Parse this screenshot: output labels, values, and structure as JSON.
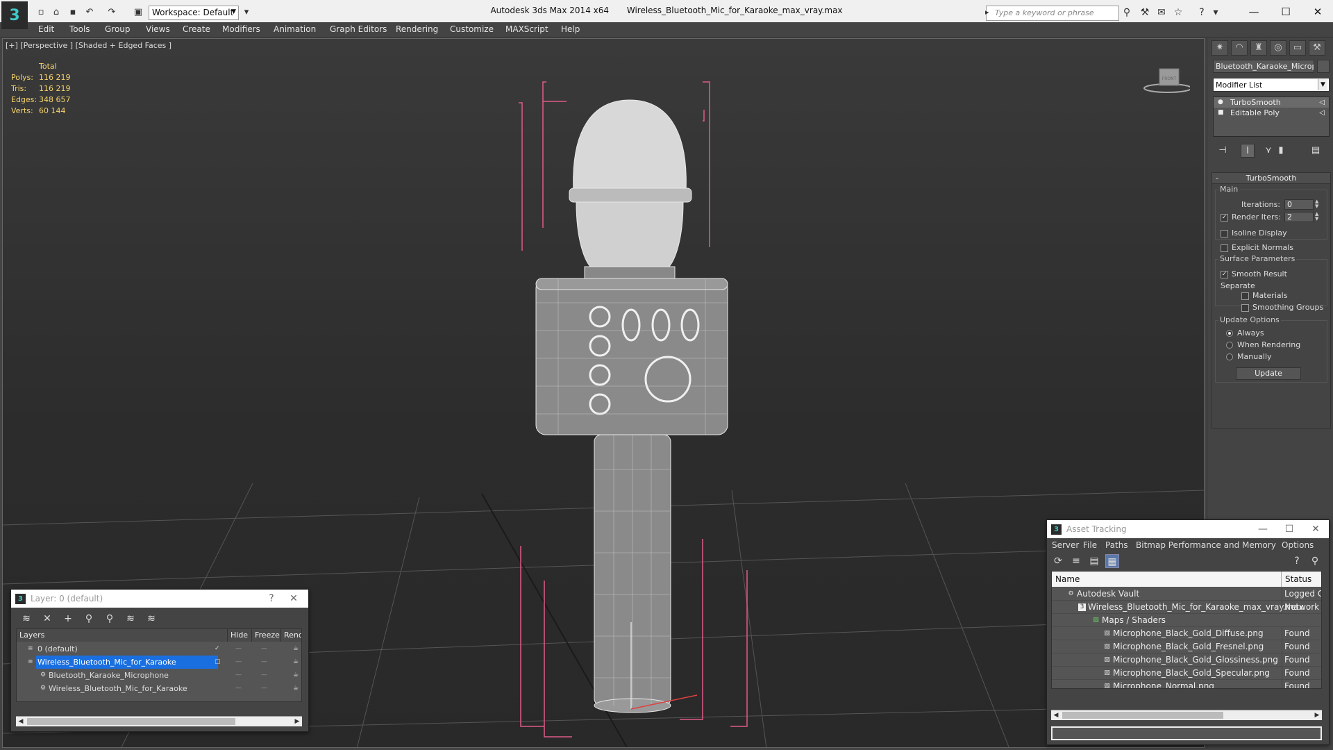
{
  "titlebar": {
    "app_name": "Autodesk 3ds Max  2014 x64",
    "file_name": "Wireless_Bluetooth_Mic_for_Karaoke_max_vray.max",
    "workspace": "Workspace: Default",
    "search_placeholder": "Type a keyword or phrase"
  },
  "menu": [
    "Edit",
    "Tools",
    "Group",
    "Views",
    "Create",
    "Modifiers",
    "Animation",
    "Graph Editors",
    "Rendering",
    "Customize",
    "MAXScript",
    "Help"
  ],
  "viewport": {
    "label": "[+] [Perspective ] [Shaded + Edged Faces ]",
    "stats": {
      "header": "Total",
      "polys_label": "Polys:",
      "polys": "116 219",
      "tris_label": "Tris:",
      "tris": "116 219",
      "edges_label": "Edges:",
      "edges": "348 657",
      "verts_label": "Verts:",
      "verts": "60 144"
    },
    "viewcube_label": "FRONT"
  },
  "command_panel": {
    "object_name": "Bluetooth_Karaoke_Micropho",
    "modifier_list": "Modifier List",
    "stack": [
      "TurboSmooth",
      "Editable Poly"
    ],
    "rollout_title": "TurboSmooth",
    "main_group": "Main",
    "iterations_label": "Iterations:",
    "iterations": "0",
    "render_iters_label": "Render Iters:",
    "render_iters": "2",
    "isoline_display": "Isoline Display",
    "explicit_normals": "Explicit Normals",
    "surface_group": "Surface Parameters",
    "smooth_result": "Smooth Result",
    "separate_label": "Separate",
    "materials": "Materials",
    "smoothing_groups": "Smoothing Groups",
    "update_group": "Update Options",
    "always": "Always",
    "when_rendering": "When Rendering",
    "manually": "Manually",
    "update_button": "Update"
  },
  "layer_window": {
    "title": "Layer: 0 (default)",
    "help": "?",
    "columns": {
      "layers": "Layers",
      "hide": "Hide",
      "freeze": "Freeze",
      "render": "Renc"
    },
    "rows": [
      "0 (default)",
      "Wireless_Bluetooth_Mic_for_Karaoke",
      "Bluetooth_Karaoke_Microphone",
      "Wireless_Bluetooth_Mic_for_Karaoke"
    ],
    "dash": "—"
  },
  "asset_window": {
    "title": "Asset Tracking",
    "menu": [
      "Server",
      "File",
      "Paths",
      "Bitmap Performance and Memory",
      "Options"
    ],
    "columns": {
      "name": "Name",
      "status": "Status"
    },
    "rows": [
      {
        "name": "Autodesk Vault",
        "status": "Logged C"
      },
      {
        "name": "Wireless_Bluetooth_Mic_for_Karaoke_max_vray.max",
        "status": "Network I"
      },
      {
        "name": "Maps / Shaders",
        "status": ""
      },
      {
        "name": "Microphone_Black_Gold_Diffuse.png",
        "status": "Found"
      },
      {
        "name": "Microphone_Black_Gold_Fresnel.png",
        "status": "Found"
      },
      {
        "name": "Microphone_Black_Gold_Glossiness.png",
        "status": "Found"
      },
      {
        "name": "Microphone_Black_Gold_Specular.png",
        "status": "Found"
      },
      {
        "name": "Microphone_Normal.png",
        "status": "Found"
      }
    ]
  },
  "colors": {
    "stats_text": "#f5d36b",
    "selection": "#1a6fe0",
    "bbox": "#e05a8a",
    "wire": "#ffffff"
  }
}
